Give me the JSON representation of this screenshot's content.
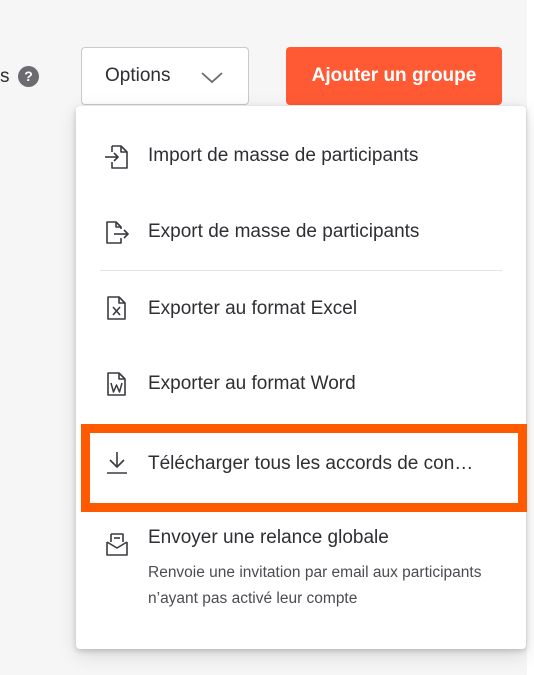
{
  "toolbar": {
    "partial_label": "s",
    "help_glyph": "?",
    "options_label": "Options",
    "add_group_label": "Ajouter un groupe"
  },
  "menu": {
    "items": [
      {
        "label": "Import de masse de participants",
        "icon": "file-import-icon"
      },
      {
        "label": "Export de masse de participants",
        "icon": "file-export-icon"
      },
      {
        "label": "Exporter au format Excel",
        "icon": "excel-file-icon"
      },
      {
        "label": "Exporter au format Word",
        "icon": "word-file-icon"
      },
      {
        "label": "Télécharger tous les accords de con…",
        "icon": "download-icon"
      },
      {
        "label": "Envoyer une relance globale",
        "icon": "mail-inbox-icon",
        "description": "Renvoie une invitation par email aux participants n’ayant pas activé leur compte"
      }
    ]
  },
  "colors": {
    "accent": "#ff5a34",
    "highlight": "#ff5a00",
    "text": "#2f2f33",
    "page_bg": "#f6f6f7"
  }
}
